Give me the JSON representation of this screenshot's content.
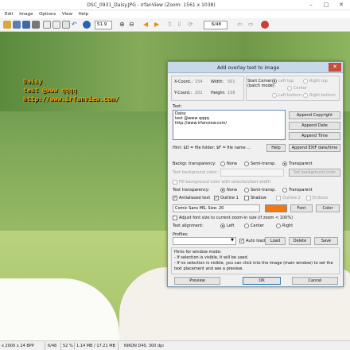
{
  "window": {
    "title": "DSC_0931_Daisy.JPG - IrfanView (Zoom: 1561 x 1038)"
  },
  "menu": [
    "Edit",
    "Image",
    "Options",
    "View",
    "Help"
  ],
  "toolbar": {
    "zoom_value": "51.9",
    "page_counter": "6/48"
  },
  "overlay_preview": {
    "line1": "Daisy",
    "line2": "test @www qqqq",
    "line3": "http://www.irfanview.com/"
  },
  "dialog": {
    "title": "Add overlay text to image",
    "x_coord_label": "X-Coord.:",
    "x_coord": "154",
    "width_label": "Width:",
    "width": "501",
    "y_coord_label": "Y-Coord.:",
    "y_coord": "201",
    "height_label": "Height:",
    "height": "156",
    "start_corner_label": "Start Corner:",
    "start_corner_note": "(batch mode)",
    "corner_left_top": "Left top",
    "corner_right_top": "Right top",
    "corner_center": "Center",
    "corner_left_bottom": "Left bottom",
    "corner_right_bottom": "Right bottom",
    "text_label": "Text:",
    "text_line1": "Daisy",
    "text_line2": "test @www qqqq",
    "text_line3": "http://www.irfanview.com/",
    "append_copyright": "Append Copyright",
    "append_date": "Append Date",
    "append_time": "Append Time",
    "append_exif": "Append EXIF date/time",
    "hint_filename": "Hint: $D = file folder; $F = file name ...",
    "help": "Help",
    "bg_transparency_label": "Backgr. transparency:",
    "opt_none": "None",
    "opt_semi": "Semi-transp.",
    "opt_transparent": "Transparent",
    "text_bg_color_label": "Text background color:",
    "set_bg_color": "Set background color",
    "fill_bg_label": "Fill background color with selection/text width",
    "text_transparency_label": "Text transparency:",
    "antialiased": "Antialiased text",
    "outline1": "Outline 1",
    "shadow": "Shadow",
    "outline2": "Outline 2",
    "emboss": "Emboss",
    "font_info": "Comic Sans MS, Size: 20",
    "font_btn": "Font",
    "color_btn": "Color",
    "font_color": "#f07a10",
    "adjust_font": "Adjust font size to current zoom-in size (if zoom < 100%)",
    "text_alignment_label": "Text alignment:",
    "align_left": "Left",
    "align_center": "Center",
    "align_right": "Right",
    "profiles_label": "Profiles:",
    "auto_load": "Auto load",
    "load": "Load",
    "delete": "Delete",
    "save": "Save",
    "hints_title": "Hints for window mode:",
    "hint1": "- If selection is visible, it will be used.",
    "hint2": "- If no selection is visible, you can click into the image (main window) to set the",
    "hint3": "text placement and see a preview.",
    "preview": "Preview",
    "ok": "OK",
    "cancel": "Cancel"
  },
  "statusbar": {
    "dims": "x 2000 x 24 BPP",
    "index": "6/48",
    "zoom": "52 %",
    "size": "1.14 MB / 17.21 MB",
    "camera": "NIKON D40, 300 dpi"
  }
}
